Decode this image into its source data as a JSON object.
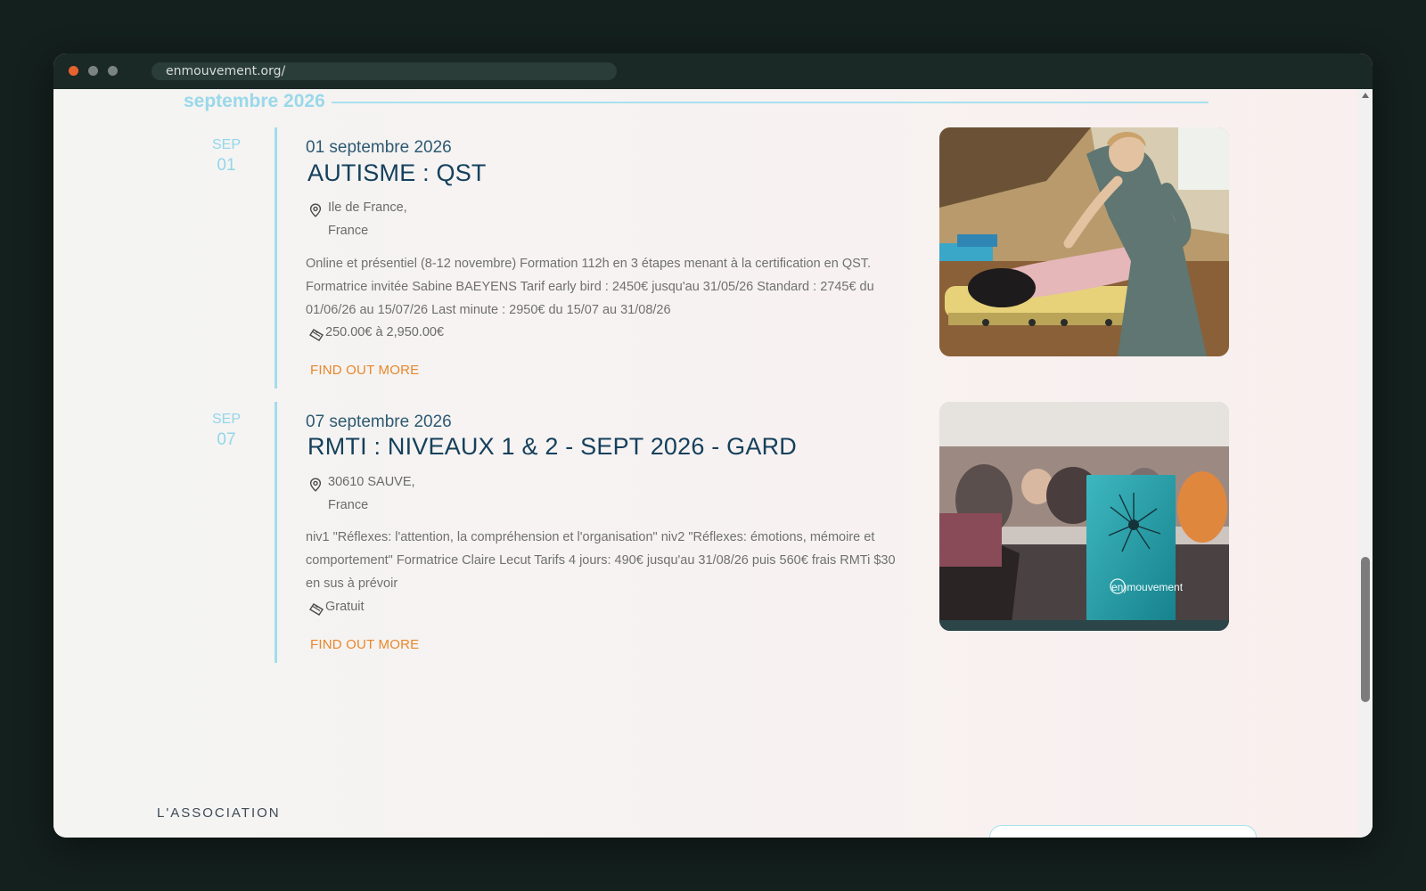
{
  "browser": {
    "url": "enmouvement.org/"
  },
  "month_heading": "septembre 2026",
  "events": [
    {
      "mon": "SEP",
      "day": "01",
      "date": "01 septembre 2026",
      "title": "AUTISME : QST",
      "location_line1": "Ile de France,",
      "location_line2": "France",
      "description": "Online et présentiel (8-12 novembre) Formation 112h en 3 étapes menant à la certification en QST. Formatrice invitée Sabine BAEYENS Tarif early bird : 2450€ jusqu'au 31/05/26 Standard : 2745€ du 01/06/26 au 15/07/26 Last minute : 2950€ du 15/07 au 31/08/26",
      "price": "250.00€ à 2,950.00€",
      "cta": "FIND OUT MORE"
    },
    {
      "mon": "SEP",
      "day": "07",
      "date": "07 septembre 2026",
      "title": "RMTI : NIVEAUX 1 & 2 - SEPT 2026 - GARD",
      "location_line1": "30610 SAUVE,",
      "location_line2": "France",
      "description": "niv1 \"Réflexes: l'attention, la compréhension et l'organisation\" niv2 \"Réflexes: émotions, mémoire et comportement\" Formatrice Claire Lecut Tarifs 4 jours: 490€ jusqu'au 31/08/26 puis 560€ frais RMTi $30 en sus à prévoir",
      "price": "Gratuit",
      "cta": "FIND OUT MORE",
      "image_caption": "en)mouvement"
    }
  ],
  "footer": {
    "association_label": "L'ASSOCIATION"
  },
  "colors": {
    "accent_orange": "#e8872a",
    "title_blue": "#15405c",
    "light_blue": "#9ad8ea"
  }
}
